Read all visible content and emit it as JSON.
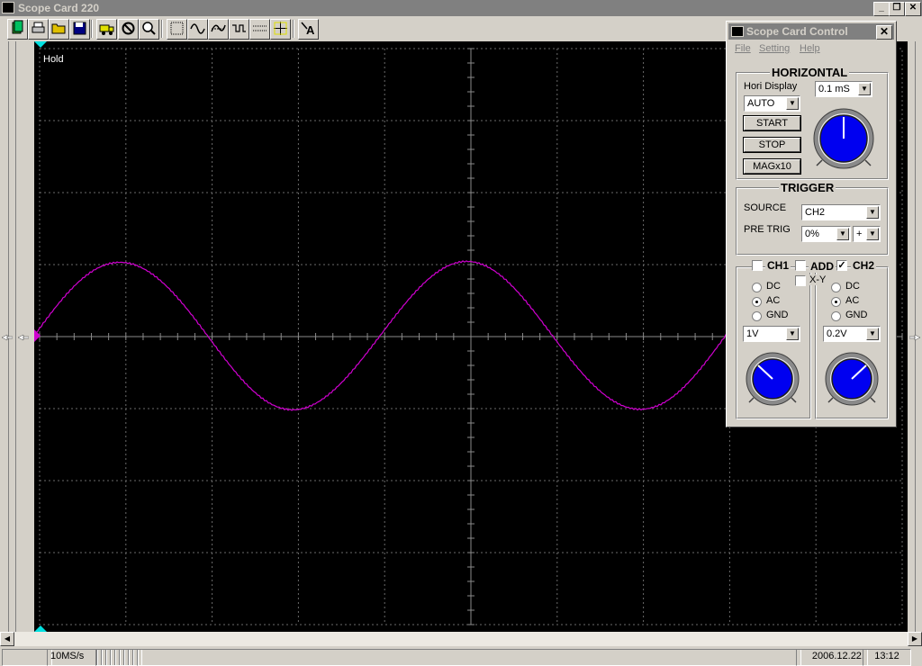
{
  "window": {
    "title": "Scope Card 220",
    "caption_buttons": [
      "_",
      "❐",
      "✕"
    ]
  },
  "toolbar": {
    "icons": [
      "open-icon",
      "print-icon",
      "folder-icon",
      "save-icon",
      "truck-icon",
      "no-icon",
      "zoom-icon",
      "grid-icon",
      "wave-icon",
      "trigger-rise-icon",
      "trigger-fall-icon",
      "dotted-line-icon",
      "cursor-icon",
      "text-icon"
    ]
  },
  "scope": {
    "status": "Hold",
    "trace_color": "#d000d0",
    "grid_color": "#6a6a6a",
    "marker_color": "#00e0e0"
  },
  "statusbar": {
    "sample_rate": "10MS/s",
    "date": "2006.12.22.",
    "time": "13:12"
  },
  "control": {
    "title": "Scope Card Control",
    "close": "✕",
    "menu": [
      "File",
      "Setting",
      "Help"
    ],
    "horizontal": {
      "heading": "HORIZONTAL",
      "hori_display_label": "Hori Display",
      "timebase": "0.1 mS",
      "mode": "AUTO",
      "start_label": "START",
      "stop_label": "STOP",
      "mag_label": "MAGx10"
    },
    "trigger": {
      "heading": "TRIGGER",
      "source_label": "SOURCE",
      "source": "CH2",
      "pretrig_label": "PRE TRIG",
      "pretrig": "0%",
      "slope": "+"
    },
    "channels": {
      "ch1_label": "CH1",
      "add_label": "ADD",
      "ch2_label": "CH2",
      "xy_label": "X-Y",
      "ch1_checked": false,
      "add_checked": false,
      "ch2_checked": true,
      "xy_checked": false,
      "coupling_options": [
        "DC",
        "AC",
        "GND"
      ],
      "ch1_coupling": "AC",
      "ch2_coupling": "AC",
      "ch1_volts": "1V",
      "ch2_volts": "0.2V"
    }
  }
}
